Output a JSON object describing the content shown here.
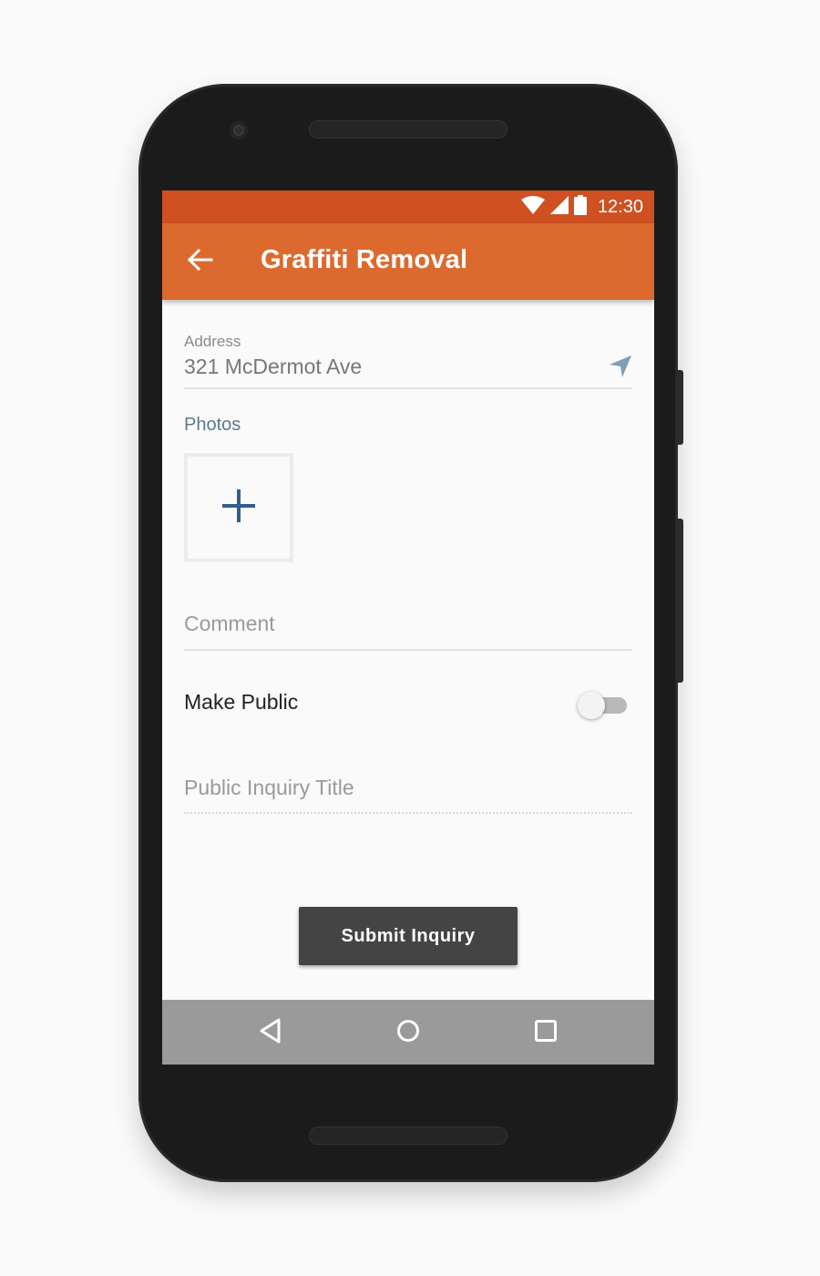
{
  "status_bar": {
    "time": "12:30",
    "icons": [
      "wifi-icon",
      "cell-signal-icon",
      "battery-icon"
    ],
    "color": "#cf5020"
  },
  "toolbar": {
    "title": "Graffiti Removal",
    "back_icon": "arrow-left-icon",
    "color": "#dc6a2e"
  },
  "form": {
    "address": {
      "label": "Address",
      "value": "321 McDermot Ave",
      "locate_icon": "navigation-arrow-icon"
    },
    "photos": {
      "label": "Photos",
      "add_icon": "plus-icon",
      "accent": "#2f5f8c"
    },
    "comment": {
      "placeholder": "Comment"
    },
    "make_public": {
      "label": "Make Public",
      "checked": false
    },
    "public_title": {
      "placeholder": "Public Inquiry Title"
    },
    "submit_label": "Submit Inquiry"
  },
  "nav_bar": {
    "buttons": [
      "back-triangle-icon",
      "home-circle-icon",
      "recents-square-icon"
    ]
  }
}
